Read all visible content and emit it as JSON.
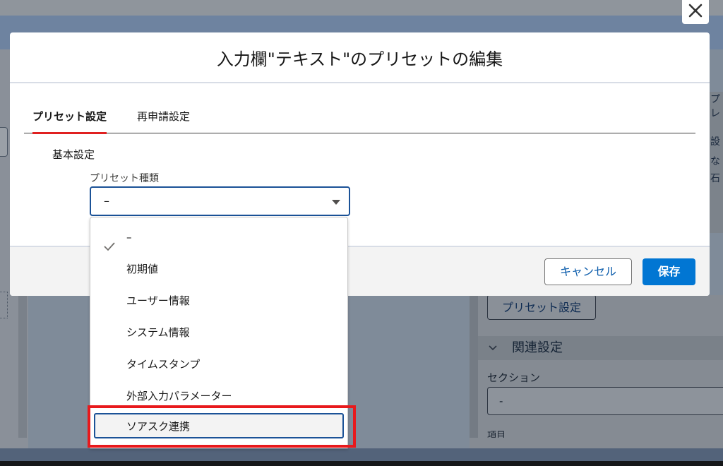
{
  "modal": {
    "title": "入力欄\"テキスト\"のプリセットの編集",
    "tabs": [
      {
        "label": "プリセット設定",
        "active": true
      },
      {
        "label": "再申請設定",
        "active": false
      }
    ],
    "section_title": "基本設定",
    "preset_type": {
      "label": "プリセット種類",
      "value": "–"
    },
    "footer": {
      "cancel_label": "キャンセル",
      "save_label": "保存"
    }
  },
  "dropdown": {
    "options": [
      {
        "label": "–",
        "selected": true
      },
      {
        "label": "初期値"
      },
      {
        "label": "ユーザー情報"
      },
      {
        "label": "システム情報"
      },
      {
        "label": "タイムスタンプ"
      },
      {
        "label": "外部入力パラメーター"
      },
      {
        "label": "ソアスク連携",
        "focused": true
      }
    ]
  },
  "background": {
    "preset_button_label": "プリセット設定",
    "related_settings_label": "関連設定",
    "section_label": "セクション",
    "section_value": "-",
    "item_label": "項目",
    "right_edge_fragments": [
      "プレ",
      "設",
      "な",
      "石"
    ]
  },
  "colors": {
    "accent": "#0176d3",
    "active_tab_underline": "#e02020",
    "highlight_box": "#e8191c",
    "focus_border": "#1b5297"
  },
  "icons": {
    "close": "close-icon",
    "select_caret": "chevron-down-icon",
    "selected_check": "check-icon",
    "collapse_chevron": "chevron-down-icon"
  }
}
